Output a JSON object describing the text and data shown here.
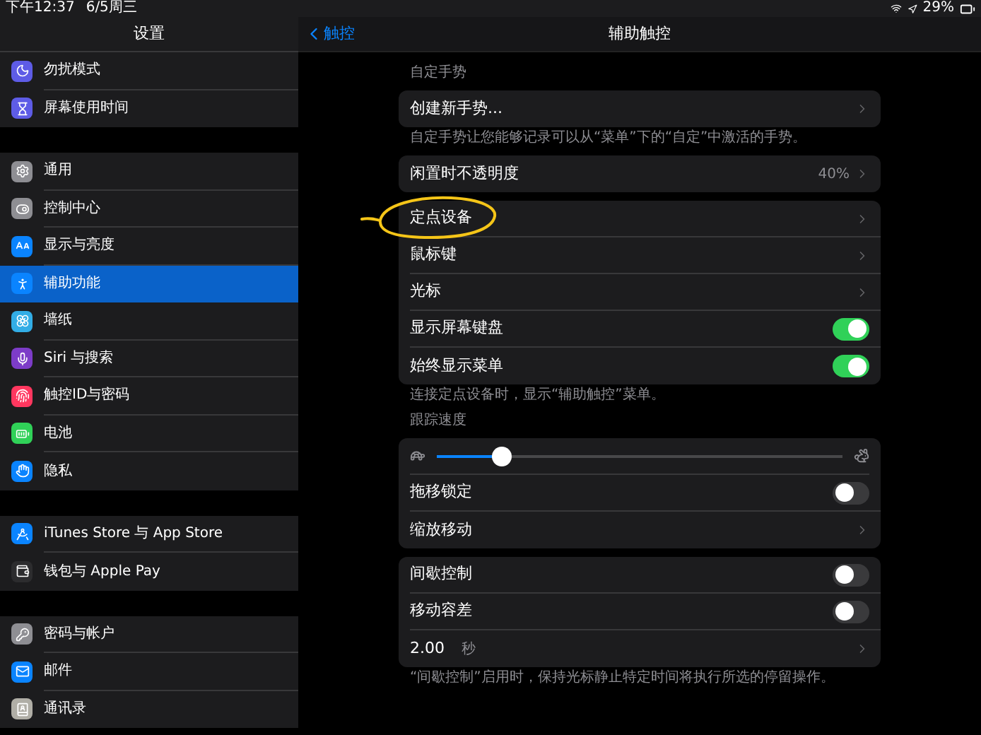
{
  "status_bar": {
    "time": "下午12:37",
    "date": "6/5周三",
    "battery": "29%"
  },
  "sidebar": {
    "title": "设置",
    "groups": [
      {
        "items": [
          {
            "label": "勿扰模式",
            "color": "#5e5ce6",
            "selected": false
          },
          {
            "label": "屏幕使用时间",
            "color": "#5e5ce6",
            "selected": false
          }
        ]
      },
      {
        "items": [
          {
            "label": "通用",
            "color": "#8e8e93",
            "selected": false
          },
          {
            "label": "控制中心",
            "color": "#8e8e93",
            "selected": false
          },
          {
            "label": "显示与亮度",
            "color": "#0a84ff",
            "selected": false
          },
          {
            "label": "辅助功能",
            "color": "#0a84ff",
            "selected": true
          },
          {
            "label": "墙纸",
            "color": "#32ade6",
            "selected": false
          },
          {
            "label": "Siri 与搜索",
            "color": "#7d3cc8",
            "selected": false
          },
          {
            "label": "触控ID与密码",
            "color": "#ff375f",
            "selected": false
          },
          {
            "label": "电池",
            "color": "#30d158",
            "selected": false
          },
          {
            "label": "隐私",
            "color": "#0a84ff",
            "selected": false
          }
        ]
      },
      {
        "items": [
          {
            "label": "iTunes Store 与 App Store",
            "color": "#0a84ff",
            "selected": false
          },
          {
            "label": "钱包与 Apple Pay",
            "color": "#2c2c2e",
            "selected": false
          }
        ]
      },
      {
        "items": [
          {
            "label": "密码与帐户",
            "color": "#8e8e93",
            "selected": false
          },
          {
            "label": "邮件",
            "color": "#0a84ff",
            "selected": false
          },
          {
            "label": "通讯录",
            "color": "#b0aea6",
            "selected": false
          }
        ]
      }
    ]
  },
  "nav": {
    "back": "触控",
    "title": "辅助触控"
  },
  "sections": [
    {
      "kind": "header",
      "text": "自定手势"
    },
    {
      "kind": "card",
      "rows": [
        {
          "kind": "nav",
          "label": "创建新手势..."
        }
      ]
    },
    {
      "kind": "footer",
      "text": "自定手势让您能够记录可以从“菜单”下的“自定”中激活的手势。"
    },
    {
      "kind": "card",
      "rows": [
        {
          "kind": "nav",
          "label": "闲置时不透明度",
          "value": "40%"
        }
      ]
    },
    {
      "kind": "card",
      "highlighted": true,
      "rows": [
        {
          "kind": "nav",
          "label": "定点设备"
        },
        {
          "kind": "nav",
          "label": "鼠标键"
        },
        {
          "kind": "nav",
          "label": "光标"
        },
        {
          "kind": "toggle",
          "label": "显示屏幕键盘",
          "on": true
        },
        {
          "kind": "toggle",
          "label": "始终显示菜单",
          "on": true
        }
      ]
    },
    {
      "kind": "footer",
      "text": "连接定点设备时，显示“辅助触控”菜单。"
    },
    {
      "kind": "header",
      "text": "跟踪速度"
    },
    {
      "kind": "card",
      "rows": [
        {
          "kind": "slider",
          "level": 0.16
        },
        {
          "kind": "toggle",
          "label": "拖移锁定",
          "on": false
        },
        {
          "kind": "nav",
          "label": "缩放移动"
        }
      ]
    },
    {
      "kind": "card",
      "rows": [
        {
          "kind": "toggle",
          "label": "间歇控制",
          "on": false
        },
        {
          "kind": "toggle",
          "label": "移动容差",
          "on": false
        },
        {
          "kind": "duration",
          "value": "2.00",
          "unit": "秒"
        }
      ]
    },
    {
      "kind": "footer",
      "text": "“间歇控制”启用时，保持光标静止特定时间将执行所选的停留操作。"
    }
  ]
}
